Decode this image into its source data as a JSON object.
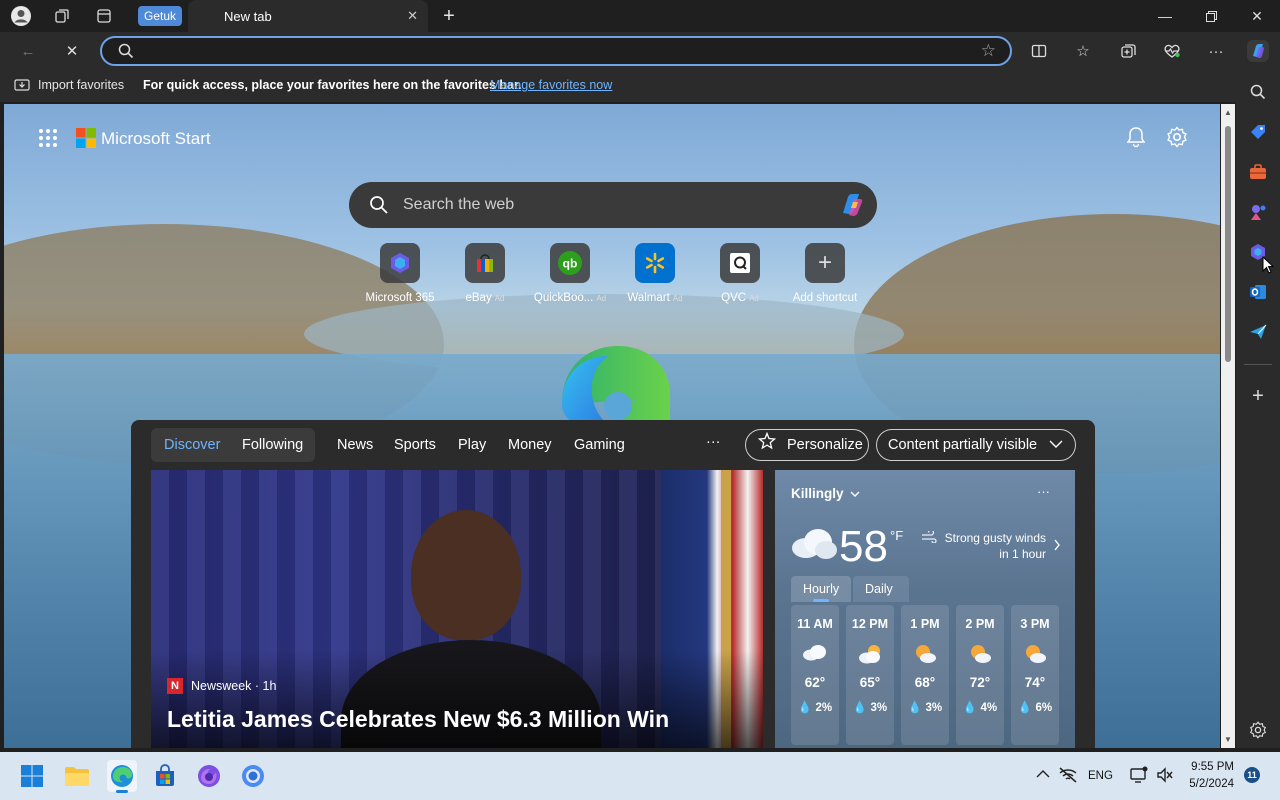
{
  "titlebar": {
    "tab_group_label": "Getuk",
    "tab_title": "New tab"
  },
  "favorites_bar": {
    "import_label": "Import favorites",
    "hint": "For quick access, place your favorites here on the favorites bar.",
    "manage_link": "Manage favorites now"
  },
  "newtab": {
    "brand": "Microsoft Start",
    "search_placeholder": "Search the web",
    "shortcuts": [
      {
        "label": "Microsoft 365",
        "ad": ""
      },
      {
        "label": "eBay",
        "ad": "Ad"
      },
      {
        "label": "QuickBoo...",
        "ad": "Ad"
      },
      {
        "label": "Walmart",
        "ad": "Ad"
      },
      {
        "label": "QVC",
        "ad": "Ad"
      },
      {
        "label": "Add shortcut",
        "ad": ""
      }
    ]
  },
  "feed": {
    "tabs": [
      "Discover",
      "Following",
      "News",
      "Sports",
      "Play",
      "Money",
      "Gaming"
    ],
    "more": "···",
    "personalize": "Personalize",
    "visibility": "Content partially visible",
    "hero": {
      "source": "Newsweek · 1h",
      "source_badge": "N",
      "headline": "Letitia James Celebrates New $6.3 Million Win"
    }
  },
  "weather": {
    "location": "Killingly",
    "temp": "58",
    "unit": "°F",
    "alert_line1": "Strong gusty winds",
    "alert_line2": "in 1 hour",
    "tab_hourly": "Hourly",
    "tab_daily": "Daily",
    "more": "···",
    "hours": [
      {
        "time": "11 AM",
        "temp": "62°",
        "precip": "2%",
        "icon": "cloudy"
      },
      {
        "time": "12 PM",
        "temp": "65°",
        "precip": "3%",
        "icon": "partly-cloudy"
      },
      {
        "time": "1 PM",
        "temp": "68°",
        "precip": "3%",
        "icon": "partly-sunny"
      },
      {
        "time": "2 PM",
        "temp": "72°",
        "precip": "4%",
        "icon": "partly-sunny"
      },
      {
        "time": "3 PM",
        "temp": "74°",
        "precip": "6%",
        "icon": "partly-sunny"
      }
    ]
  },
  "taskbar": {
    "lang": "ENG",
    "time": "9:55 PM",
    "date": "5/2/2024",
    "notif_count": "11"
  },
  "colors": {
    "accent": "#6fa3e8",
    "link": "#6eb4ff",
    "discover": "#6eb4ff"
  }
}
